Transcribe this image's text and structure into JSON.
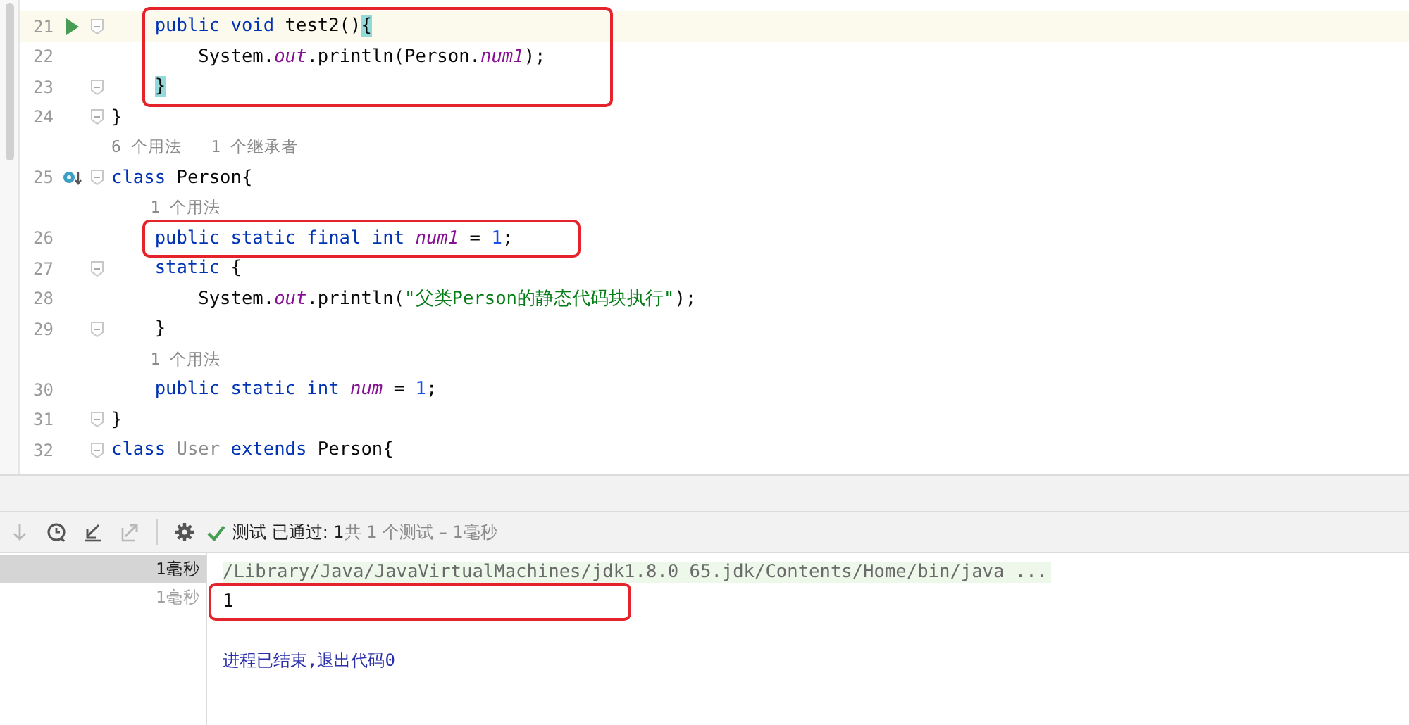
{
  "editor": {
    "lines": [
      {
        "number": "21",
        "current": true,
        "gutter": {
          "kind": "run"
        },
        "fold": true,
        "boxed": true,
        "tokens": [
          {
            "kind": "keyword",
            "text": "    public void "
          },
          {
            "kind": "plain",
            "text": "test2()"
          },
          {
            "kind": "plain",
            "text": "{",
            "matched": true
          }
        ]
      },
      {
        "number": "22",
        "current": false,
        "fold": false,
        "boxed": true,
        "tokens": [
          {
            "kind": "plain",
            "text": "        System."
          },
          {
            "kind": "field",
            "text": "out"
          },
          {
            "kind": "plain",
            "text": ".println(Person."
          },
          {
            "kind": "field",
            "text": "num1"
          },
          {
            "kind": "plain",
            "text": ");"
          }
        ]
      },
      {
        "number": "23",
        "current": false,
        "fold": true,
        "boxed": true,
        "tokens": [
          {
            "kind": "plain",
            "text": "    }",
            "matched": true
          }
        ]
      },
      {
        "number": "24",
        "current": false,
        "fold": true,
        "boxed": false,
        "tokens": [
          {
            "kind": "plain",
            "text": "}"
          }
        ]
      },
      {
        "hint": "6 个用法   1 个继承者",
        "boxed": false
      },
      {
        "number": "25",
        "current": false,
        "gutter": {
          "kind": "override"
        },
        "fold": true,
        "boxed": false,
        "tokens": [
          {
            "kind": "keyword",
            "text": "class "
          },
          {
            "kind": "plain",
            "text": "Person{"
          }
        ]
      },
      {
        "hint": "    1 个用法",
        "boxed": false
      },
      {
        "number": "26",
        "current": false,
        "fold": false,
        "boxed": true,
        "tokens": [
          {
            "kind": "keyword",
            "text": "    public static final int "
          },
          {
            "kind": "field",
            "text": "num1"
          },
          {
            "kind": "plain",
            "text": " = "
          },
          {
            "kind": "number",
            "text": "1"
          },
          {
            "kind": "plain",
            "text": ";"
          }
        ]
      },
      {
        "number": "27",
        "current": false,
        "fold": true,
        "boxed": false,
        "tokens": [
          {
            "kind": "keyword",
            "text": "    static "
          },
          {
            "kind": "plain",
            "text": "{"
          }
        ]
      },
      {
        "number": "28",
        "current": false,
        "fold": false,
        "boxed": false,
        "tokens": [
          {
            "kind": "plain",
            "text": "        System."
          },
          {
            "kind": "field",
            "text": "out"
          },
          {
            "kind": "plain",
            "text": ".println("
          },
          {
            "kind": "string",
            "text": "\"父类Person的静态代码块执行\""
          },
          {
            "kind": "plain",
            "text": ");"
          }
        ]
      },
      {
        "number": "29",
        "current": false,
        "fold": true,
        "boxed": false,
        "tokens": [
          {
            "kind": "plain",
            "text": "    }"
          }
        ]
      },
      {
        "hint": "    1 个用法",
        "boxed": false
      },
      {
        "number": "30",
        "current": false,
        "fold": false,
        "boxed": false,
        "tokens": [
          {
            "kind": "keyword",
            "text": "    public static int "
          },
          {
            "kind": "field",
            "text": "num"
          },
          {
            "kind": "plain",
            "text": " = "
          },
          {
            "kind": "number",
            "text": "1"
          },
          {
            "kind": "plain",
            "text": ";"
          }
        ]
      },
      {
        "number": "31",
        "current": false,
        "fold": true,
        "boxed": false,
        "tokens": [
          {
            "kind": "plain",
            "text": "}"
          }
        ]
      },
      {
        "number": "32",
        "current": false,
        "fold": true,
        "boxed": false,
        "tokens": [
          {
            "kind": "keyword",
            "text": "class "
          },
          {
            "kind": "unused",
            "text": "User "
          },
          {
            "kind": "keyword",
            "text": "extends "
          },
          {
            "kind": "plain",
            "text": "Person{"
          }
        ]
      }
    ]
  },
  "toolbar": {
    "buttons": [
      {
        "kind": "down",
        "disabled": true
      },
      {
        "kind": "history",
        "disabled": false
      },
      {
        "kind": "import",
        "disabled": false
      },
      {
        "kind": "export",
        "disabled": true
      },
      {
        "kind": "settings",
        "disabled": false
      }
    ],
    "status_passed": "测试 已通过: 1",
    "status_detail": "共 1 个测试 – 1毫秒"
  },
  "test_tree": {
    "items": [
      {
        "duration": "1毫秒",
        "selected": true
      },
      {
        "duration": "1毫秒",
        "selected": false
      }
    ]
  },
  "console": {
    "lines": [
      {
        "kind": "command",
        "text": "/Library/Java/JavaVirtualMachines/jdk1.8.0_65.jdk/Contents/Home/bin/java ...",
        "boxed": false
      },
      {
        "kind": "output",
        "text": "1",
        "boxed": true
      },
      {
        "kind": "exit",
        "text": "进程已结束,退出代码0",
        "boxed": false
      }
    ]
  }
}
